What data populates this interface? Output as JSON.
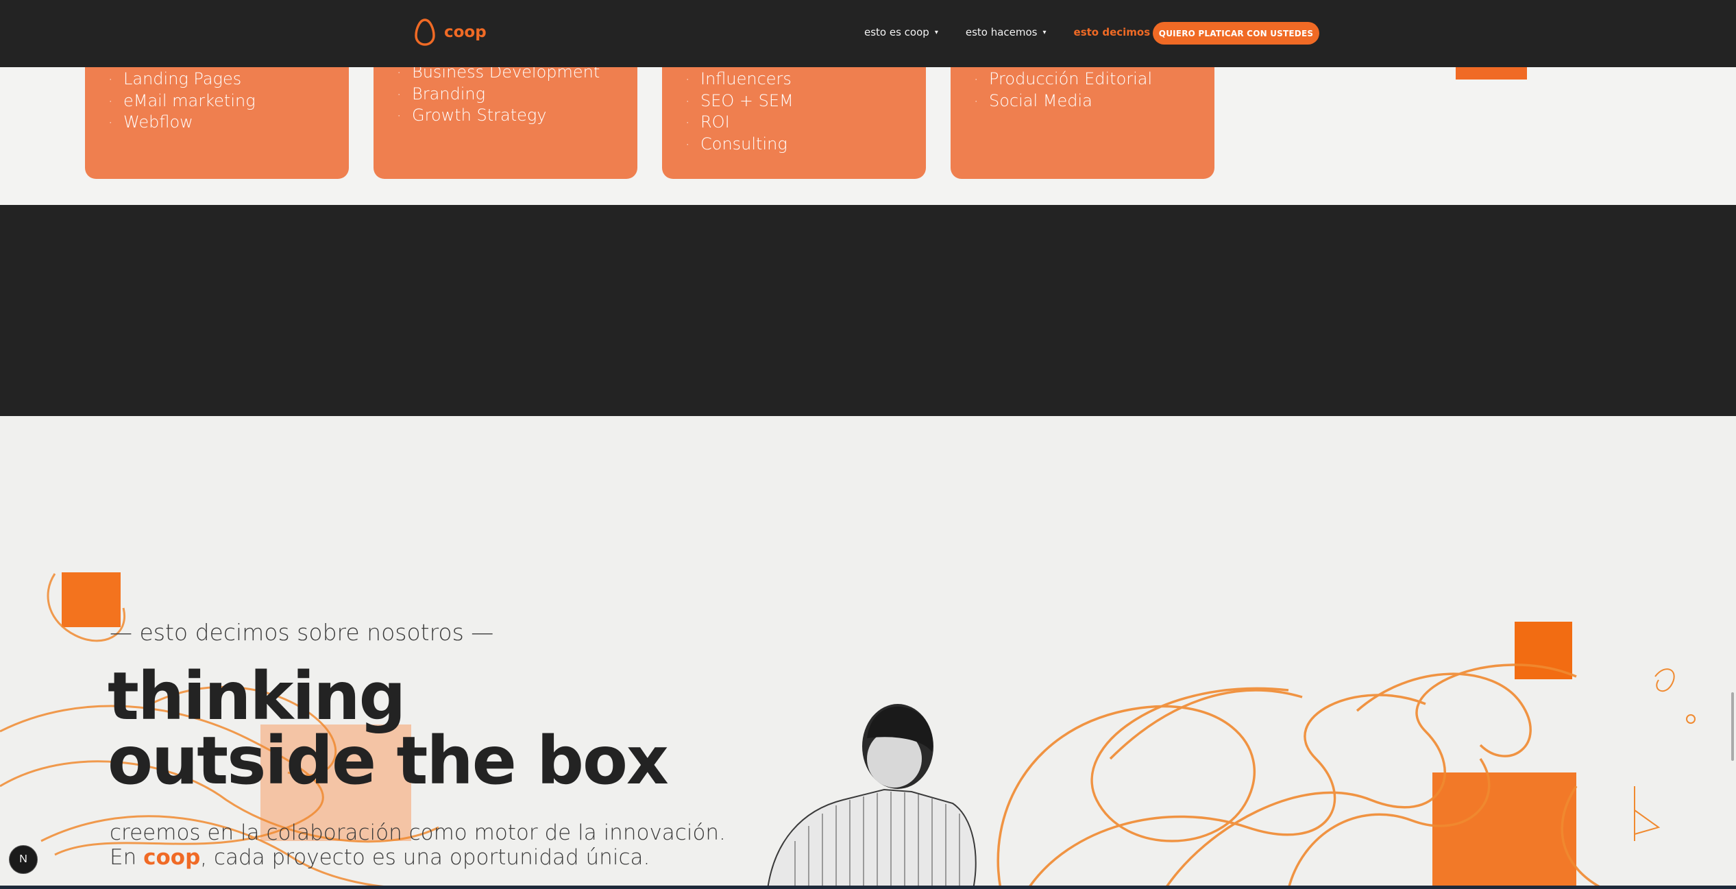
{
  "brand": {
    "name": "coop"
  },
  "nav": {
    "items": [
      {
        "label": "esto es coop",
        "active": false
      },
      {
        "label": "esto hacemos",
        "active": false
      },
      {
        "label": "esto decimos",
        "active": true
      }
    ],
    "caret": "▾",
    "cta_label": "QUIERO PLATICAR CON USTEDES"
  },
  "cards": [
    {
      "items": [
        "Landing Pages",
        "eMail marketing",
        "Webflow"
      ]
    },
    {
      "items": [
        "Business Development",
        "Branding",
        "Growth Strategy"
      ]
    },
    {
      "items": [
        "Influencers",
        "SEO + SEM",
        "ROI",
        "Consulting"
      ]
    },
    {
      "items": [
        "Producción Editorial",
        "Social Media"
      ]
    }
  ],
  "hero": {
    "eyebrow": "— esto decimos sobre nosotros —",
    "headline_line1": "thinking",
    "headline_line2": "outside the box",
    "sub_line1": "creemos en la colaboración como motor de la innovación.",
    "sub_line2_prefix": "En ",
    "sub_line2_brand": "coop",
    "sub_line2_suffix": ", cada proyecto es una oportunidad única."
  },
  "badge": {
    "letter": "N"
  },
  "colors": {
    "accent": "#f06a25",
    "card": "#ef7f4f",
    "dark": "#232323"
  }
}
